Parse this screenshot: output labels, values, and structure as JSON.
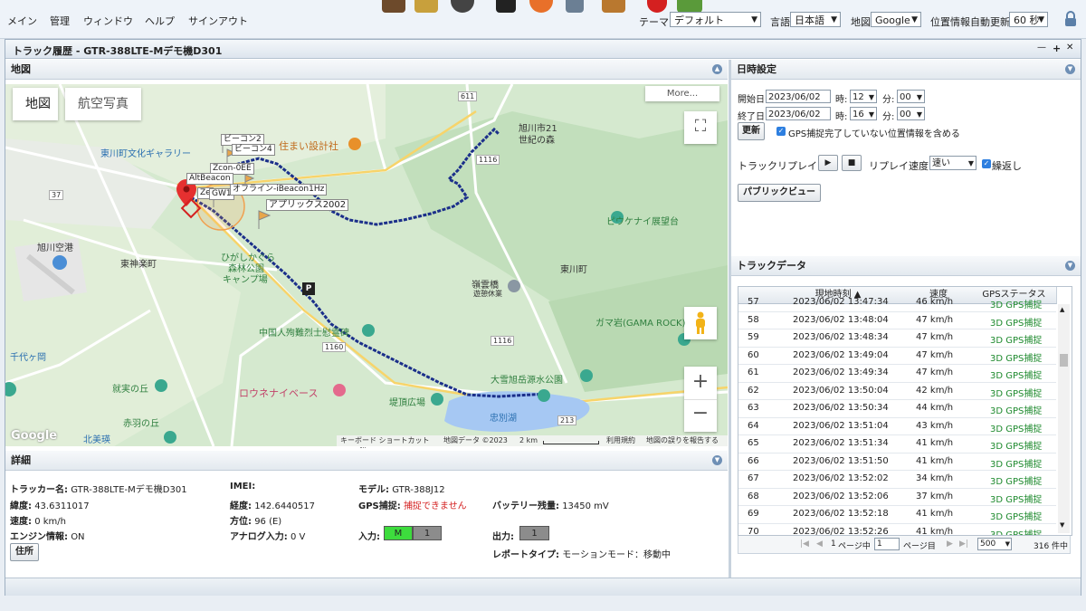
{
  "menu": {
    "items": [
      "メイン",
      "管理",
      "ウィンドウ",
      "ヘルプ",
      "サインアウト"
    ],
    "theme_label": "テーマ",
    "theme_value": "デフォルト",
    "language_label": "言語",
    "language_value": "日本語",
    "map_label": "地図",
    "map_value": "Google",
    "autoupdate_label": "位置情報自動更新",
    "autoupdate_value": "60 秒"
  },
  "window": {
    "title": "トラック履歴 - GTR-388LTE-Mデモ機D301",
    "controls": [
      "—",
      "+",
      "✕"
    ]
  },
  "map_panel": {
    "title": "地図",
    "tab_map": "地図",
    "tab_satellite": "航空写真",
    "more_label": "More...",
    "pois": {
      "asahikawa21": "旭川市21",
      "asahikawa21b": "世紀の森",
      "higashikawa_gallery": "東川町文化ギャラリー",
      "sumai": "住まい設計社",
      "asahikawa_airport": "旭川空港",
      "higashi_kagura": "東神楽町",
      "higashikagura_park1": "ひがしかぐら",
      "higashikagura_park2": "森林公園",
      "higashikagura_park3": "キャンプ場",
      "bieinai": "ピウケナイ展望台",
      "higashikawa_town": "東川町",
      "reisetsu": "嶺雲橋",
      "reisetsu2": "遊憩休業",
      "chugoku": "中国人殉難烈士慰霊碑",
      "gamaiwa": "ガマ岩(GAMA ROCK)",
      "chitose": "千代ヶ岡",
      "shuujitsu": "就実の丘",
      "akabane": "赤羽の丘",
      "rounay": "ロウネナイベース",
      "taisetsu": "大雪旭岳源水公園",
      "teicho": "堤頂広場",
      "chubetsu": "忠別湖",
      "kitabie": "北美瑛",
      "route611": "611",
      "route1160": "1160",
      "route1116": "1116",
      "route213": "213",
      "route37": "37",
      "route1116b": "1116"
    },
    "tags": {
      "beacon2": "ビーコン2",
      "beacon4": "ビーコン4",
      "zcon": "Zcon-0EE",
      "alt": "AltBeacon",
      "gw1": "GW1",
      "offline": "オフライン-iBeacon1Hz",
      "applix": "アプリックス2002",
      "ze": "Ze"
    },
    "parking_label": "P",
    "footer": {
      "shortcut": "キーボード ショートカット",
      "mapdata": "地図データ ©2023",
      "scale": "2 km",
      "terms": "利用規約",
      "report": "地図の誤りを報告する"
    },
    "google_logo": "Google"
  },
  "details_panel": {
    "title": "詳細",
    "tracker_name_label": "トラッカー名:",
    "tracker_name_value": "GTR-388LTE-Mデモ機D301",
    "imei_label": "IMEI:",
    "model_label": "モデル:",
    "model_value": "GTR-388J12",
    "lat_label": "緯度:",
    "lat_value": "43.6311017",
    "lng_label": "経度:",
    "lng_value": "142.6440517",
    "gps_label": "GPS捕捉:",
    "gps_value": "捕捉できません",
    "battery_label": "バッテリー残量:",
    "battery_value": "13450 mV",
    "speed_label": "速度:",
    "speed_value": "0 km/h",
    "heading_label": "方位:",
    "heading_value": "96 (E)",
    "engine_label": "エンジン情報:",
    "engine_value": "ON",
    "analog_label": "アナログ入力:",
    "analog_value": "0 V",
    "input_label": "入力:",
    "input_m": "M",
    "input_1": "1",
    "output_label": "出力:",
    "output_1": "1",
    "address_button": "住所",
    "report_type_label": "レポートタイプ:",
    "report_type_value": "モーションモード：移動中"
  },
  "datetime_panel": {
    "title": "日時設定",
    "start_label": "開始日",
    "start_date": "2023/06/02",
    "start_hour": "12",
    "start_min": "00",
    "end_label": "終了日",
    "end_date": "2023/06/02",
    "end_hour": "16",
    "end_min": "00",
    "hour_label": "時:",
    "min_label": "分:",
    "update_button": "更新",
    "include_label": "GPS捕捉完了していない位置情報を含める",
    "replay_label": "トラックリプレイ",
    "replay_speed_label": "リプレイ速度",
    "replay_speed_value": "速い",
    "repeat_label": "繰返し",
    "public_view_button": "パブリックビュー"
  },
  "track_panel": {
    "title": "トラックデータ",
    "columns": [
      "現地時刻 ▲",
      "速度",
      "GPSステータス"
    ],
    "rows": [
      {
        "no": "57",
        "time": "2023/06/02 13:47:34",
        "speed": "46 km/h",
        "status": "3D GPS捕捉"
      },
      {
        "no": "58",
        "time": "2023/06/02 13:48:04",
        "speed": "47 km/h",
        "status": "3D GPS捕捉"
      },
      {
        "no": "59",
        "time": "2023/06/02 13:48:34",
        "speed": "47 km/h",
        "status": "3D GPS捕捉"
      },
      {
        "no": "60",
        "time": "2023/06/02 13:49:04",
        "speed": "47 km/h",
        "status": "3D GPS捕捉"
      },
      {
        "no": "61",
        "time": "2023/06/02 13:49:34",
        "speed": "47 km/h",
        "status": "3D GPS捕捉"
      },
      {
        "no": "62",
        "time": "2023/06/02 13:50:04",
        "speed": "42 km/h",
        "status": "3D GPS捕捉"
      },
      {
        "no": "63",
        "time": "2023/06/02 13:50:34",
        "speed": "44 km/h",
        "status": "3D GPS捕捉"
      },
      {
        "no": "64",
        "time": "2023/06/02 13:51:04",
        "speed": "43 km/h",
        "status": "3D GPS捕捉"
      },
      {
        "no": "65",
        "time": "2023/06/02 13:51:34",
        "speed": "41 km/h",
        "status": "3D GPS捕捉"
      },
      {
        "no": "66",
        "time": "2023/06/02 13:51:50",
        "speed": "41 km/h",
        "status": "3D GPS捕捉"
      },
      {
        "no": "67",
        "time": "2023/06/02 13:52:02",
        "speed": "34 km/h",
        "status": "3D GPS捕捉"
      },
      {
        "no": "68",
        "time": "2023/06/02 13:52:06",
        "speed": "37 km/h",
        "status": "3D GPS捕捉"
      },
      {
        "no": "69",
        "time": "2023/06/02 13:52:18",
        "speed": "41 km/h",
        "status": "3D GPS捕捉"
      },
      {
        "no": "70",
        "time": "2023/06/02 13:52:26",
        "speed": "41 km/h",
        "status": "3D GPS捕捉"
      }
    ],
    "pager_page_label": "ページ中",
    "pager_page_value": "1",
    "pager_page_suffix": "ページ目",
    "pager_size": "500",
    "pager_count": "316 件中"
  },
  "colors": {
    "track": "#1b2f8a",
    "status_green": "#1e8a2e",
    "input_green": "#3ddc3d",
    "alert_red": "#d42020"
  }
}
